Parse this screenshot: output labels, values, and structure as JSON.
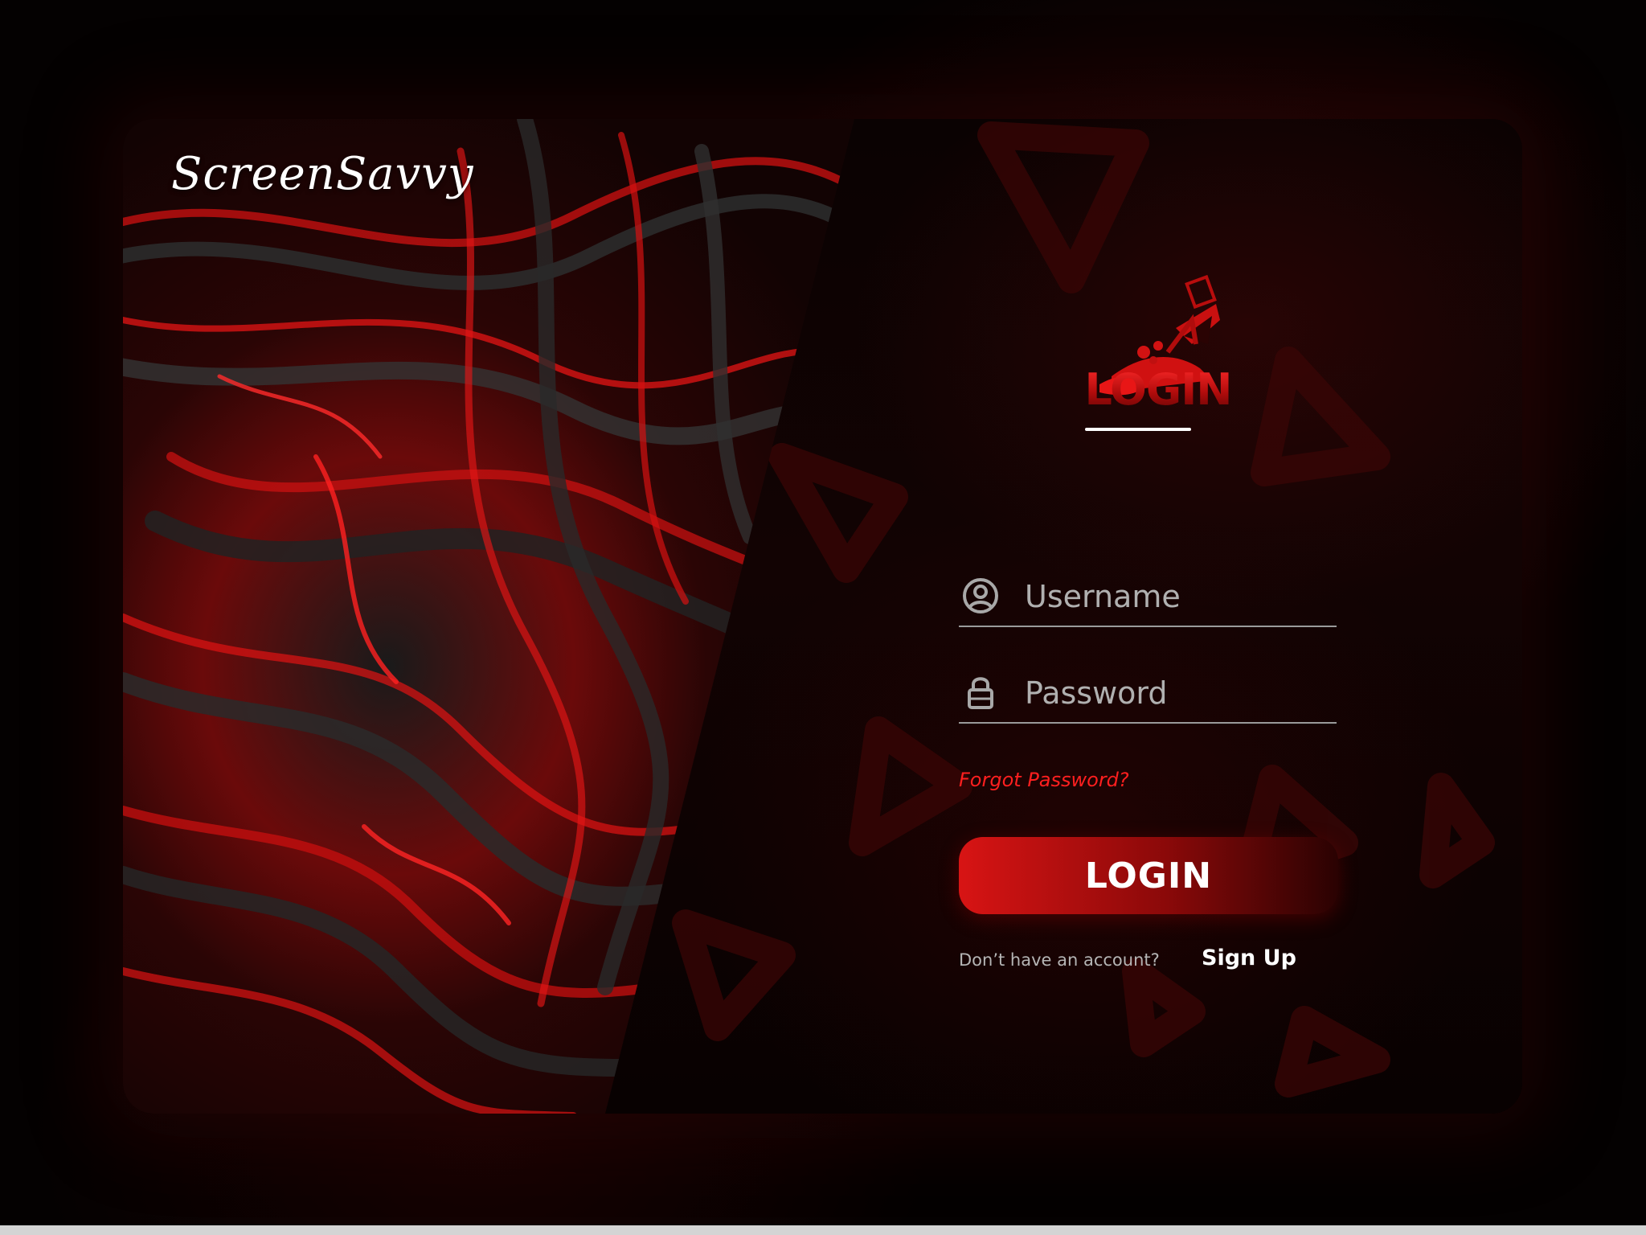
{
  "brand": {
    "name": "ScreenSavvy"
  },
  "login_form": {
    "heading": "LOGIN",
    "username": {
      "placeholder": "Username",
      "icon": "user-circle-icon"
    },
    "password": {
      "placeholder": "Password",
      "icon": "lock-icon"
    },
    "forgot_password": "Forgot Password?",
    "submit_label": "LOGIN",
    "signup_prompt": "Don’t have an account?",
    "signup_link": "Sign Up"
  },
  "theme": {
    "accent": "#e01414",
    "dark_red": "#5a0303",
    "background": "#040101",
    "text_muted": "#b5b5b5",
    "text_primary": "#ffffff"
  }
}
